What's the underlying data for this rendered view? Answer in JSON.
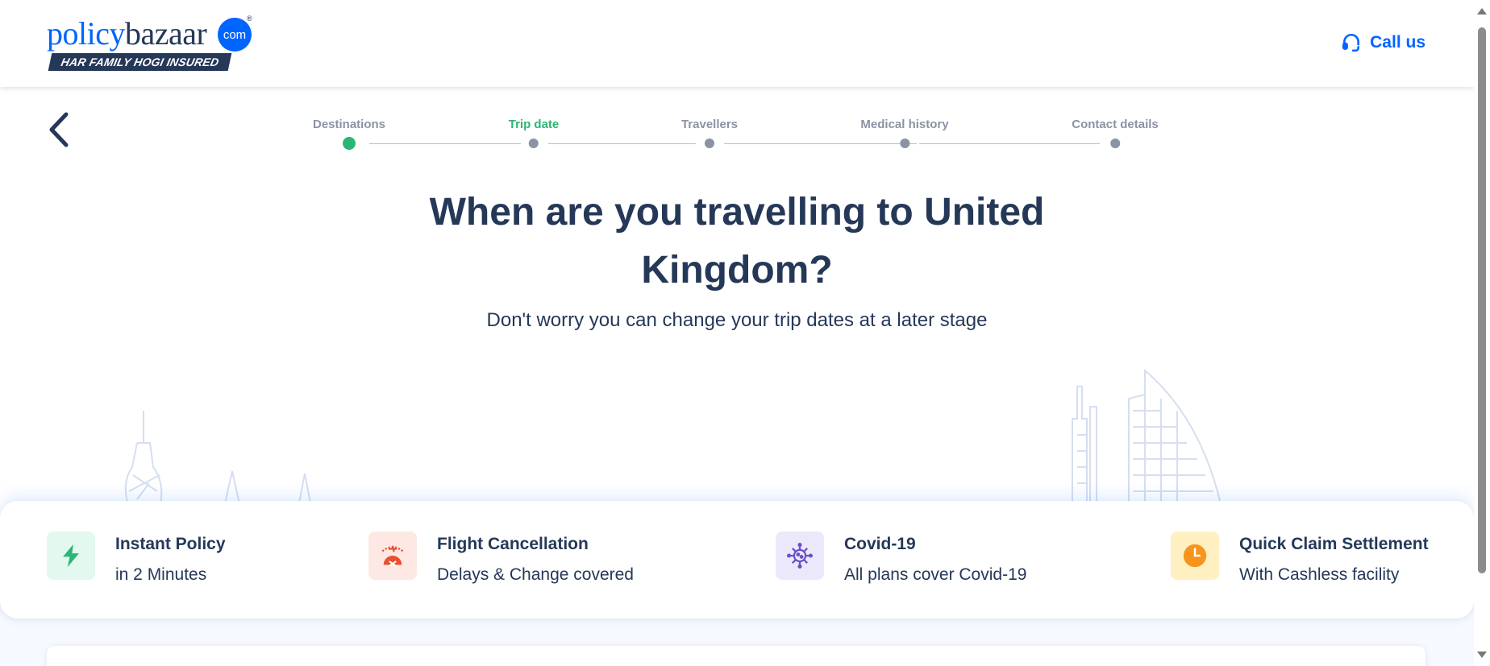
{
  "header": {
    "logo_policy": "policy",
    "logo_bazaar": "bazaar",
    "logo_com": "com",
    "logo_registered": "®",
    "logo_tagline": "HAR FAMILY HOGI INSURED",
    "call_label": "Call us",
    "call_icon": "headset-icon"
  },
  "nav": {
    "back_icon": "chevron-left-icon"
  },
  "stepper": {
    "steps": [
      {
        "label": "Destinations",
        "state": "done"
      },
      {
        "label": "Trip date",
        "state": "active"
      },
      {
        "label": "Travellers",
        "state": "pending"
      },
      {
        "label": "Medical history",
        "state": "pending"
      },
      {
        "label": "Contact details",
        "state": "pending"
      }
    ]
  },
  "main": {
    "title": "When are you travelling to United Kingdom?",
    "subtitle": "Don't worry you can change your trip dates at a later stage"
  },
  "features": [
    {
      "title": "Instant Policy",
      "subtitle": "in 2 Minutes",
      "icon": "lightning-icon",
      "bg": "#e3f8ee",
      "color": "#2bb673"
    },
    {
      "title": "Flight Cancellation",
      "subtitle": "Delays & Change covered",
      "icon": "flight-cancel-icon",
      "bg": "#fde8e4",
      "color": "#e8502f"
    },
    {
      "title": "Covid-19",
      "subtitle": "All plans cover Covid-19",
      "icon": "virus-icon",
      "bg": "#ece8fb",
      "color": "#6a4fc9"
    },
    {
      "title": "Quick Claim Settlement",
      "subtitle": "With Cashless facility",
      "icon": "clock-icon",
      "bg": "#fff0c2",
      "color": "#f7941d"
    }
  ],
  "colors": {
    "brand_blue": "#0065ff",
    "navy": "#253858",
    "green": "#2bb673"
  }
}
